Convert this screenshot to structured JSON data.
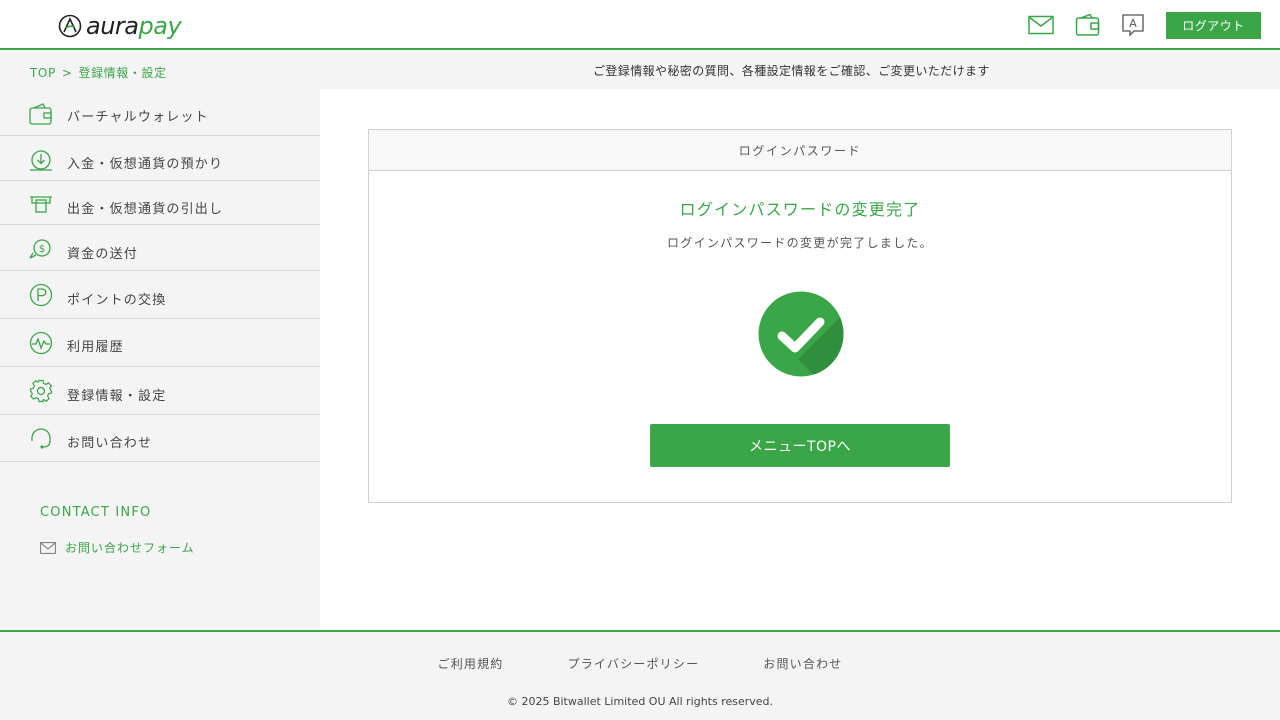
{
  "header": {
    "logo_prefix": "aura",
    "logo_suffix": "pay",
    "icons": [
      "mail-icon",
      "wallet-icon",
      "language-icon"
    ],
    "language_glyph": "A",
    "logout_label": "ログアウト"
  },
  "subbar": {
    "breadcrumb_top": "TOP",
    "breadcrumb_sep": ">",
    "breadcrumb_current": "登録情報・設定",
    "description": "ご登録情報や秘密の質問、各種設定情報をご確認、ご変更いただけます"
  },
  "sidebar": {
    "items": [
      {
        "label": "バーチャルウォレット",
        "icon": "wallet-icon"
      },
      {
        "label": "入金・仮想通貨の預かり",
        "icon": "deposit-icon"
      },
      {
        "label": "出金・仮想通貨の引出し",
        "icon": "withdraw-icon"
      },
      {
        "label": "資金の送付",
        "icon": "transfer-icon"
      },
      {
        "label": "ポイントの交換",
        "icon": "point-icon"
      },
      {
        "label": "利用履歴",
        "icon": "history-icon"
      },
      {
        "label": "登録情報・設定",
        "icon": "settings-icon"
      },
      {
        "label": "お問い合わせ",
        "icon": "support-icon"
      }
    ],
    "contact_title": "CONTACT INFO",
    "contact_link": "お問い合わせフォーム"
  },
  "main": {
    "card_header": "ログインパスワード",
    "title": "ログインパスワードの変更完了",
    "message": "ログインパスワードの変更が完了しました。",
    "button_label": "メニューTOPへ"
  },
  "footer": {
    "links": [
      "ご利用規約",
      "プライバシーポリシー",
      "お問い合わせ"
    ],
    "copyright": "© 2025 Bitwallet Limited OU All rights reserved."
  },
  "colors": {
    "accent": "#3aa648",
    "sidebar_bg": "#f4f4f4"
  }
}
